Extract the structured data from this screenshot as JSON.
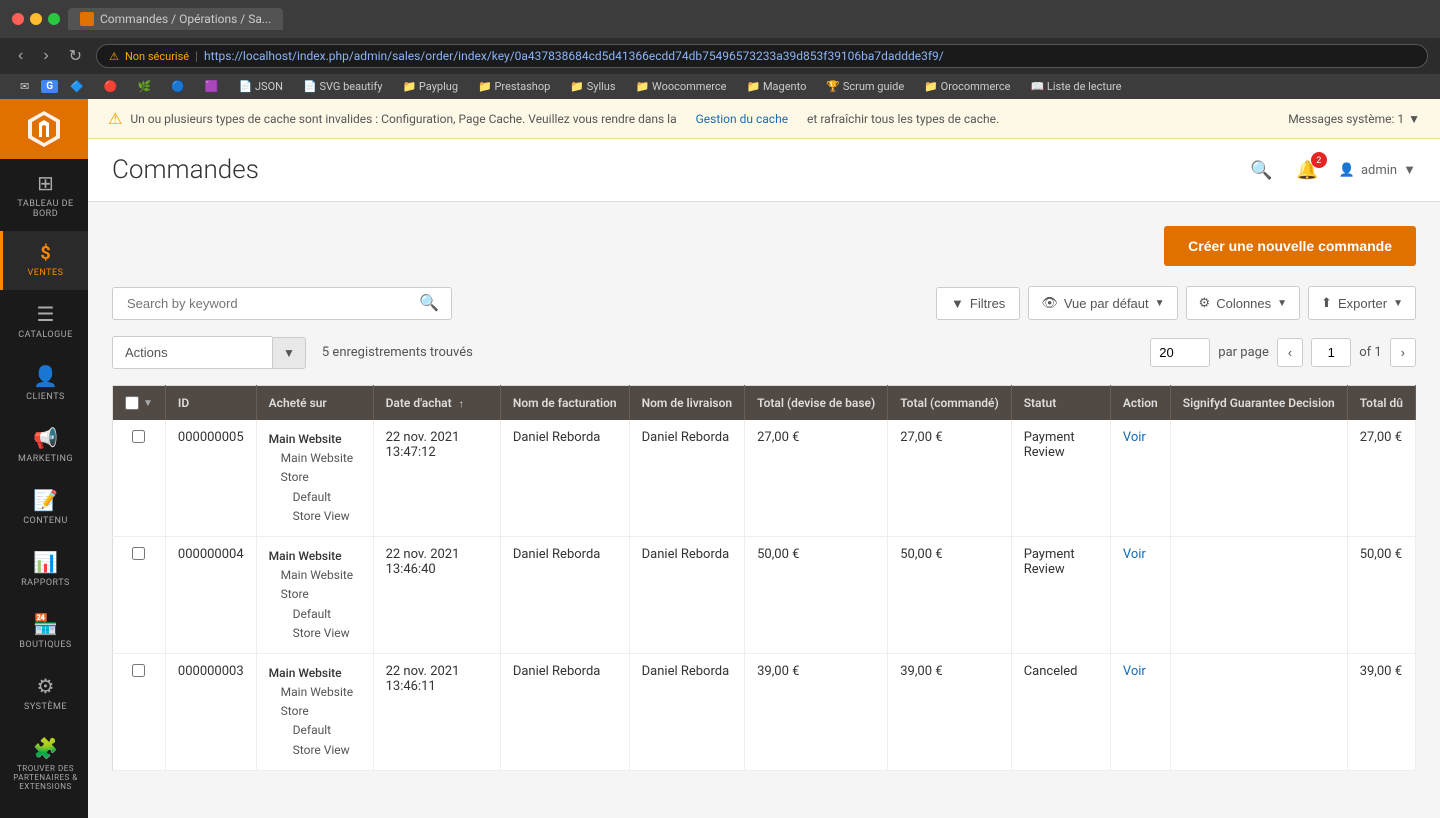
{
  "browser": {
    "tab_title": "Commandes / Opérations / Sa...",
    "favicon": "M",
    "url": "https://localhost/index.php/admin/sales/order/index/key/0a437838684cd5d41366ecdd74db75496573233a39d853f39106ba7daddde3f9/",
    "insecure_label": "Non sécurisé",
    "bookmarks": [
      {
        "label": "JSON",
        "icon": "📄"
      },
      {
        "label": "SVG beautify",
        "icon": "📄"
      },
      {
        "label": "Payplug",
        "icon": "📁"
      },
      {
        "label": "Prestashop",
        "icon": "📁"
      },
      {
        "label": "Syllus",
        "icon": "📁"
      },
      {
        "label": "Woocommerce",
        "icon": "📁"
      },
      {
        "label": "Magento",
        "icon": "📁"
      },
      {
        "label": "Scrum guide",
        "icon": "🏆"
      },
      {
        "label": "Orocommerce",
        "icon": "📁"
      },
      {
        "label": "Liste de lecture",
        "icon": "📖"
      }
    ]
  },
  "system_alert": {
    "message": "Un ou plusieurs types de cache sont invalides : Configuration, Page Cache. Veuillez vous rendre dans la",
    "link_text": "Gestion du cache",
    "message_after": "et rafraîchir tous les types de cache.",
    "messages_count_label": "Messages système: 1"
  },
  "sidebar": {
    "items": [
      {
        "id": "tableau-de-bord",
        "label": "TABLEAU DE BORD",
        "icon": "⊞"
      },
      {
        "id": "ventes",
        "label": "VENTES",
        "icon": "$",
        "active": true
      },
      {
        "id": "catalogue",
        "label": "CATALOGUE",
        "icon": "☰"
      },
      {
        "id": "clients",
        "label": "CLIENTS",
        "icon": "👤"
      },
      {
        "id": "marketing",
        "label": "MARKETING",
        "icon": "📢"
      },
      {
        "id": "contenu",
        "label": "CONTENU",
        "icon": "📝"
      },
      {
        "id": "rapports",
        "label": "RAPPORTS",
        "icon": "📊"
      },
      {
        "id": "boutiques",
        "label": "BOUTIQUES",
        "icon": "🏪"
      },
      {
        "id": "systeme",
        "label": "SYSTÈME",
        "icon": "⚙"
      },
      {
        "id": "partenaires",
        "label": "TROUVER DES PARTENAIRES & EXTENSIONS",
        "icon": "🧩"
      }
    ]
  },
  "page": {
    "title": "Commandes",
    "header": {
      "search_icon": "🔍",
      "notification_count": "2",
      "user_label": "admin"
    }
  },
  "toolbar": {
    "create_button_label": "Créer une nouvelle commande",
    "search_placeholder": "Search by keyword",
    "filters_label": "Filtres",
    "view_label": "Vue par défaut",
    "columns_label": "Colonnes",
    "export_label": "Exporter"
  },
  "actions_row": {
    "actions_label": "Actions",
    "records_count": "5 enregistrements trouvés",
    "per_page": "20",
    "per_page_label": "par page",
    "current_page": "1",
    "total_pages": "of 1"
  },
  "table": {
    "columns": [
      {
        "id": "id",
        "label": "ID"
      },
      {
        "id": "achete_sur",
        "label": "Acheté sur"
      },
      {
        "id": "date_achat",
        "label": "Date d'achat",
        "sortable": true
      },
      {
        "id": "nom_facturation",
        "label": "Nom de facturation"
      },
      {
        "id": "nom_livraison",
        "label": "Nom de livraison"
      },
      {
        "id": "total_base",
        "label": "Total (devise de base)"
      },
      {
        "id": "total_commande",
        "label": "Total (commandé)"
      },
      {
        "id": "statut",
        "label": "Statut"
      },
      {
        "id": "action",
        "label": "Action"
      },
      {
        "id": "signifyd",
        "label": "Signifyd Guarantee Decision"
      },
      {
        "id": "total_du",
        "label": "Total dû"
      }
    ],
    "rows": [
      {
        "id": "000000005",
        "store1": "Main Website",
        "store2": "Main Website Store",
        "store3": "Default Store View",
        "date": "22 nov. 2021 13:47:12",
        "nom_facturation": "Daniel Reborda",
        "nom_livraison": "Daniel Reborda",
        "total_base": "27,00 €",
        "total_commande": "27,00 €",
        "statut": "Payment Review",
        "action": "Voir",
        "signifyd": "",
        "total_du": "27,00 €"
      },
      {
        "id": "000000004",
        "store1": "Main Website",
        "store2": "Main Website Store",
        "store3": "Default Store View",
        "date": "22 nov. 2021 13:46:40",
        "nom_facturation": "Daniel Reborda",
        "nom_livraison": "Daniel Reborda",
        "total_base": "50,00 €",
        "total_commande": "50,00 €",
        "statut": "Payment Review",
        "action": "Voir",
        "signifyd": "",
        "total_du": "50,00 €"
      },
      {
        "id": "000000003",
        "store1": "Main Website",
        "store2": "Main Website Store",
        "store3": "Default Store View",
        "date": "22 nov. 2021 13:46:11",
        "nom_facturation": "Daniel Reborda",
        "nom_livraison": "Daniel Reborda",
        "total_base": "39,00 €",
        "total_commande": "39,00 €",
        "statut": "Canceled",
        "action": "Voir",
        "signifyd": "",
        "total_du": "39,00 €"
      }
    ]
  }
}
